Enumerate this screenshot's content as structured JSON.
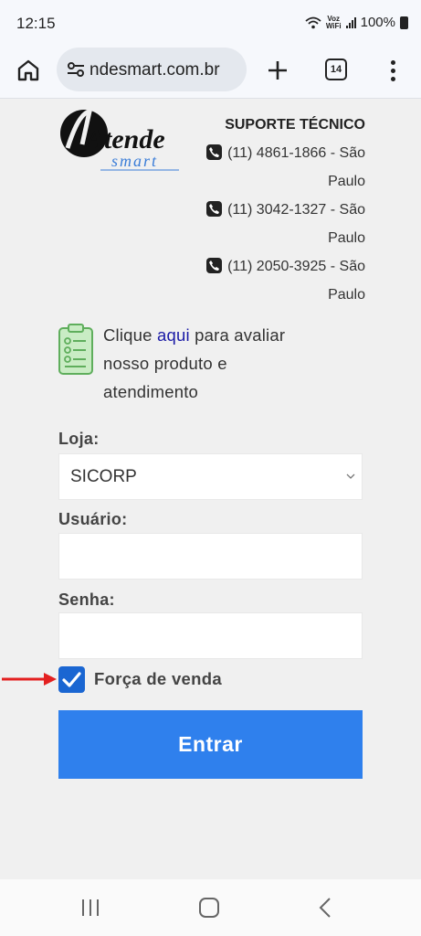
{
  "status_bar": {
    "time": "12:15",
    "network_top": "Voz",
    "network_bottom": "WiFi",
    "battery": "100%"
  },
  "browser": {
    "url": "ndesmart.com.br",
    "tab_count": "14"
  },
  "header": {
    "logo_main": "Atende",
    "logo_sub": "smart",
    "support_title": "SUPORTE TÉCNICO",
    "phones": [
      {
        "number": "(11) 4861-1866 - São",
        "city": "Paulo"
      },
      {
        "number": "(11) 3042-1327 - São",
        "city": "Paulo"
      },
      {
        "number": "(11) 2050-3925 - São",
        "city": "Paulo"
      }
    ]
  },
  "rating": {
    "line1_before": "Clique ",
    "link": "aqui",
    "line1_after": " para avaliar",
    "line2": "nosso produto e",
    "line3": "atendimento"
  },
  "form": {
    "store_label": "Loja:",
    "store_value": "SICORP",
    "user_label": "Usuário:",
    "user_value": "",
    "password_label": "Senha:",
    "password_value": "",
    "sales_force_label": "Força de venda",
    "sales_force_checked": true,
    "submit_label": "Entrar"
  },
  "colors": {
    "primary_button": "#2f80ed",
    "checkbox": "#1a66d2",
    "arrow": "#e32020",
    "link": "#1a1aa6"
  }
}
